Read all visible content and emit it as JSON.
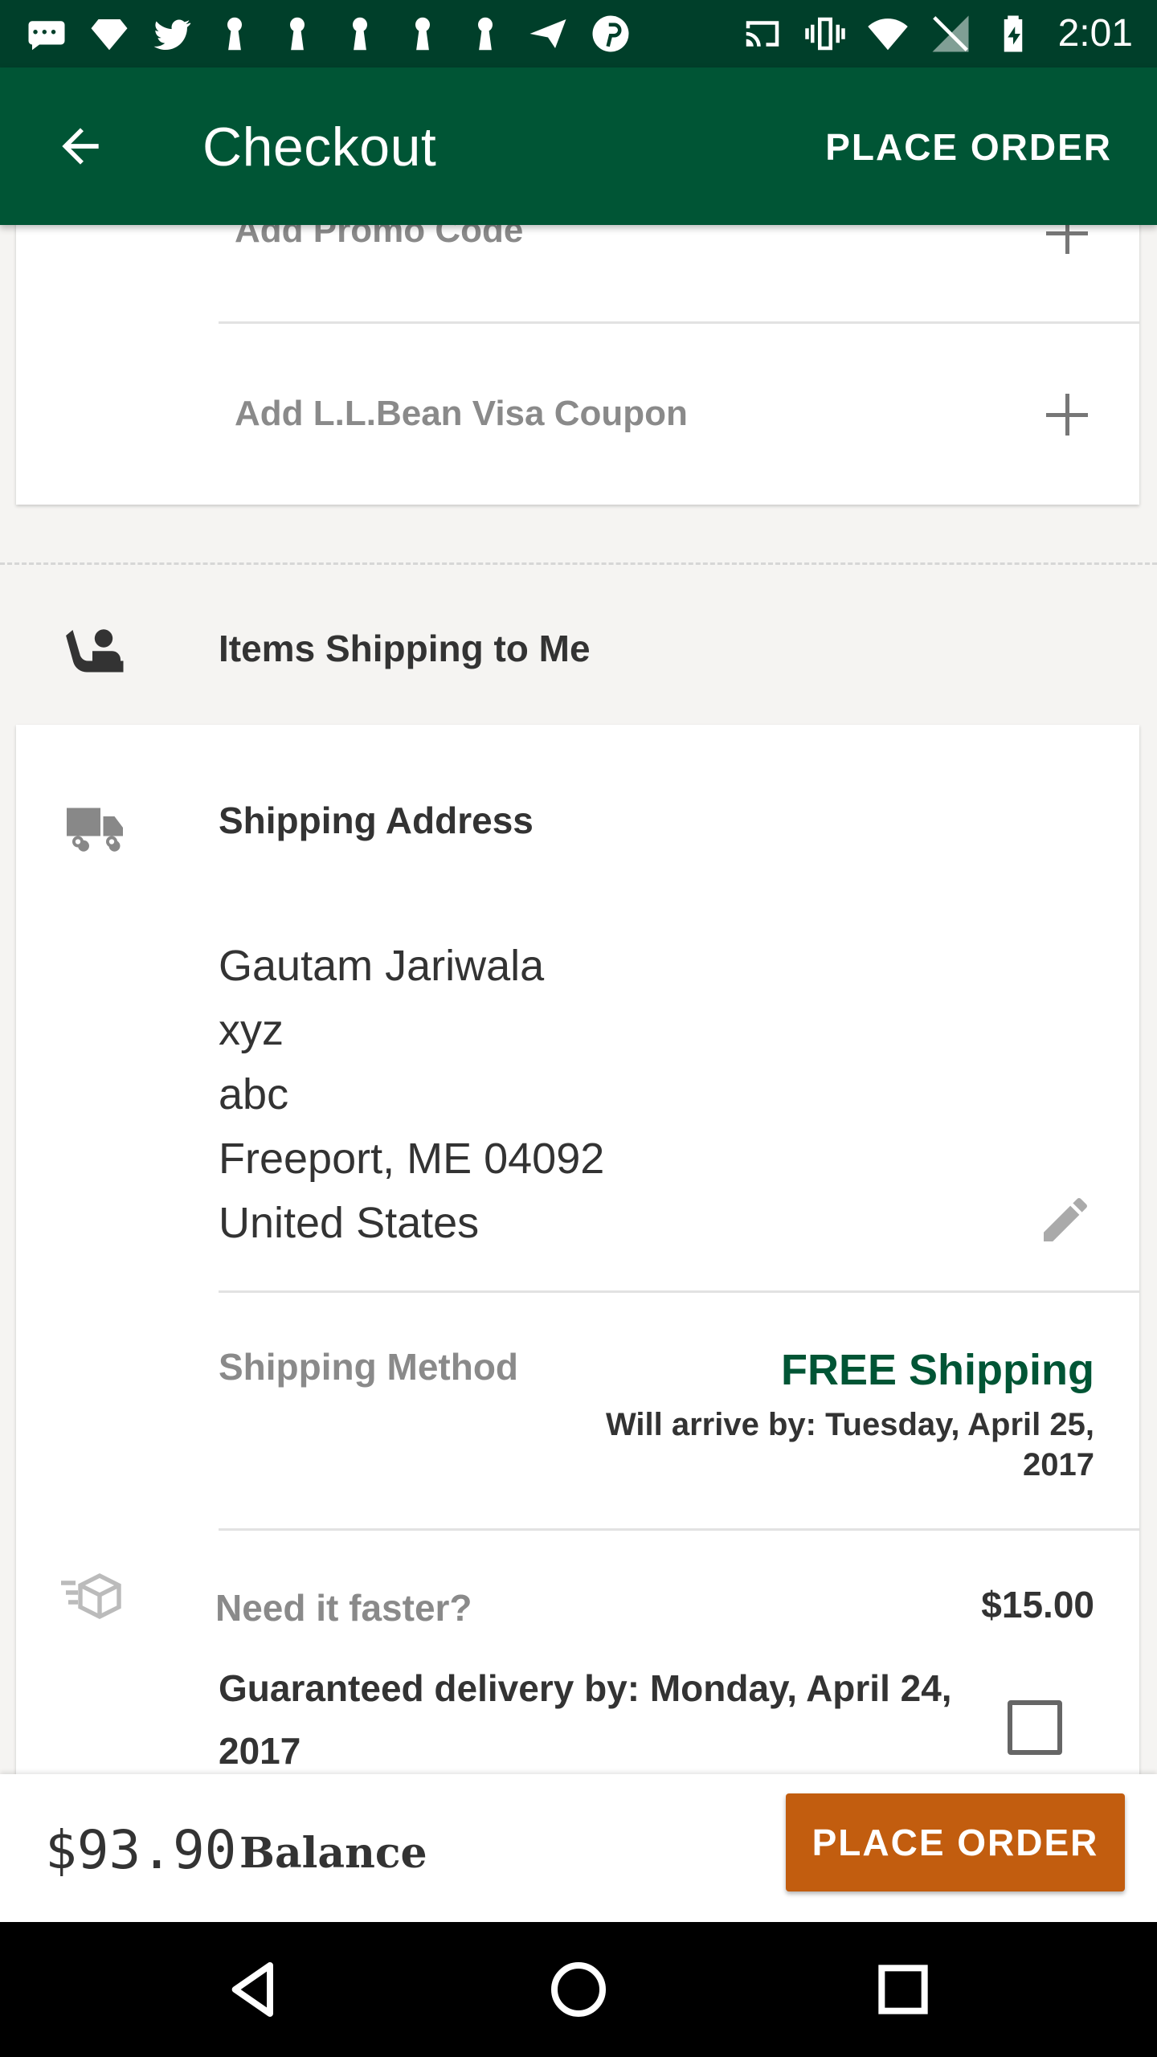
{
  "status_bar": {
    "time": "2:01"
  },
  "app_bar": {
    "title": "Checkout",
    "action": "PLACE ORDER"
  },
  "promo": {
    "promo_code_label": "Add Promo Code",
    "visa_coupon_label": "Add L.L.Bean Visa Coupon"
  },
  "section": {
    "label": "Items Shipping to Me"
  },
  "shipping": {
    "title": "Shipping Address",
    "address_lines": [
      "Gautam Jariwala",
      "xyz",
      "abc",
      "Freeport, ME 04092",
      "United States"
    ],
    "method_label": "Shipping Method",
    "method_value": "FREE Shipping",
    "arrival_line1": "Will arrive by: Tuesday, April 25,",
    "arrival_line2": "2017",
    "faster_label": "Need it faster?",
    "faster_price": "$15.00",
    "guarantee_line1": "Guaranteed delivery by: Monday, April 24,",
    "guarantee_line2": "2017"
  },
  "bottom_bar": {
    "balance_amount": "$93.90",
    "balance_label": "Balance",
    "button_label": "PLACE ORDER"
  },
  "colors": {
    "brand_green": "#005535",
    "status_green": "#003f2a",
    "order_orange": "#c25d0f"
  }
}
